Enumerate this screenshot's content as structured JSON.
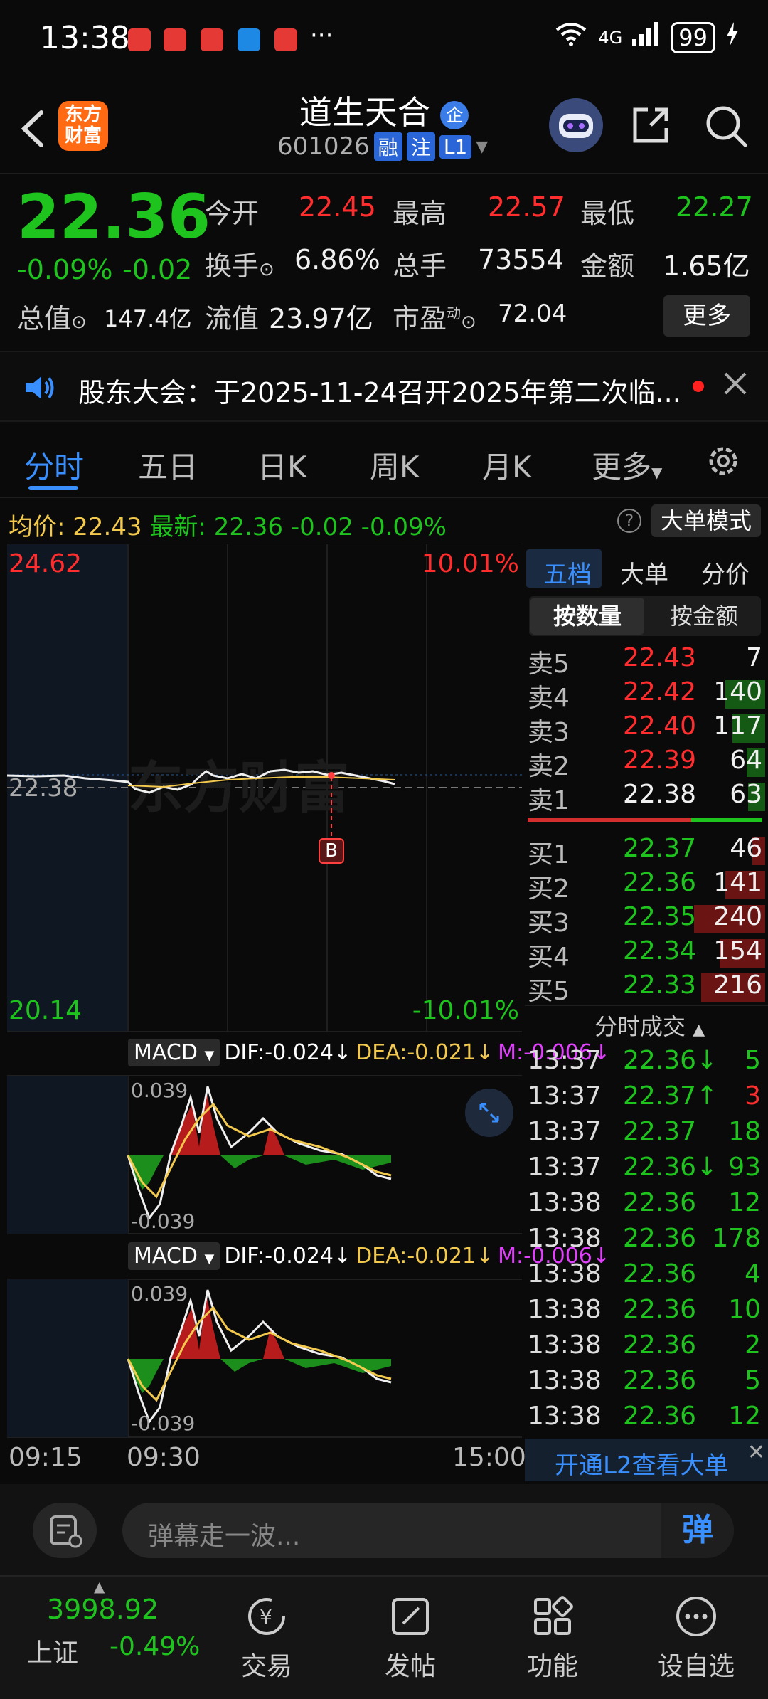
{
  "status": {
    "time": "13:38",
    "more_dots": "···",
    "network": "4G",
    "battery": "99"
  },
  "header": {
    "logo_text": "东方\n财富",
    "stock_name": "道生天合",
    "badge": "企",
    "code": "601026",
    "tags": [
      "融",
      "注",
      "L1"
    ]
  },
  "quote": {
    "price": "22.36",
    "pct": "-0.09%",
    "chg": "-0.02",
    "open_label": "今开",
    "open": "22.45",
    "high_label": "最高",
    "high": "22.57",
    "low_label": "最低",
    "low": "22.27",
    "turnover_label": "换手",
    "turnover": "6.86%",
    "volume_label": "总手",
    "volume": "73554",
    "amount_label": "金额",
    "amount": "1.65亿",
    "mktcap_label": "总值",
    "mktcap": "147.4亿",
    "float_label": "流值",
    "float": "23.97亿",
    "pe_label": "市盈",
    "pe_sup": "动",
    "pe": "72.04",
    "more": "更多"
  },
  "notice": {
    "text": "股东大会：于2025-11-24召开2025年第二次临..."
  },
  "tabs": [
    "分时",
    "五日",
    "日K",
    "周K",
    "月K",
    "更多"
  ],
  "infobar": {
    "avg_label": "均价:",
    "avg": "22.43",
    "latest_label": "最新:",
    "latest": "22.36",
    "chg": "-0.02",
    "pct": "-0.09%",
    "big_order_mode": "大单模式"
  },
  "chart": {
    "top_price": "24.62",
    "top_pct": "10.01%",
    "mid_price": "22.38",
    "bottom_price": "20.14",
    "bottom_pct": "-10.01%",
    "watermark": "东方财富",
    "b_marker": "B",
    "time_start": "09:15",
    "time_open": "09:30",
    "time_end": "15:00"
  },
  "macd": {
    "label": "MACD",
    "dif": "DIF:-0.024↓",
    "dea": "DEA:-0.021↓",
    "m": "M:-0.006↓",
    "top": "0.039",
    "bottom": "-0.039"
  },
  "rpanel": {
    "tabs": [
      "五档",
      "大单",
      "分价"
    ],
    "sub_tabs": [
      "按数量",
      "按金额"
    ],
    "asks": [
      {
        "label": "卖5",
        "price": "22.43",
        "vol": "7"
      },
      {
        "label": "卖4",
        "price": "22.42",
        "vol": "140"
      },
      {
        "label": "卖3",
        "price": "22.40",
        "vol": "117"
      },
      {
        "label": "卖2",
        "price": "22.39",
        "vol": "64"
      },
      {
        "label": "卖1",
        "price": "22.38",
        "vol": "63"
      }
    ],
    "bids": [
      {
        "label": "买1",
        "price": "22.37",
        "vol": "46"
      },
      {
        "label": "买2",
        "price": "22.36",
        "vol": "141"
      },
      {
        "label": "买3",
        "price": "22.35",
        "vol": "240"
      },
      {
        "label": "买4",
        "price": "22.34",
        "vol": "154"
      },
      {
        "label": "买5",
        "price": "22.33",
        "vol": "216"
      }
    ],
    "trades_title": "分时成交",
    "trades": [
      {
        "time": "13:37",
        "price": "22.36↓",
        "vol": "5",
        "color": "green"
      },
      {
        "time": "13:37",
        "price": "22.37↑",
        "vol": "3",
        "color": "red"
      },
      {
        "time": "13:37",
        "price": "22.37",
        "vol": "18",
        "color": "green"
      },
      {
        "time": "13:37",
        "price": "22.36↓",
        "vol": "93",
        "color": "green"
      },
      {
        "time": "13:38",
        "price": "22.36",
        "vol": "12",
        "color": "green"
      },
      {
        "time": "13:38",
        "price": "22.36",
        "vol": "178",
        "color": "green"
      },
      {
        "time": "13:38",
        "price": "22.36",
        "vol": "4",
        "color": "green"
      },
      {
        "time": "13:38",
        "price": "22.36",
        "vol": "10",
        "color": "green"
      },
      {
        "time": "13:38",
        "price": "22.36",
        "vol": "2",
        "color": "green"
      },
      {
        "time": "13:38",
        "price": "22.36",
        "vol": "5",
        "color": "green"
      },
      {
        "time": "13:38",
        "price": "22.36",
        "vol": "12",
        "color": "green"
      }
    ],
    "l2_link": "开通L2查看大单"
  },
  "chat": {
    "placeholder": "弹幕走一波...",
    "danmu_btn": "弹"
  },
  "bottomnav": {
    "index_value": "3998.92",
    "index_name": "上证",
    "index_pct": "-0.49%",
    "items": [
      "交易",
      "发帖",
      "功能",
      "设自选"
    ]
  }
}
